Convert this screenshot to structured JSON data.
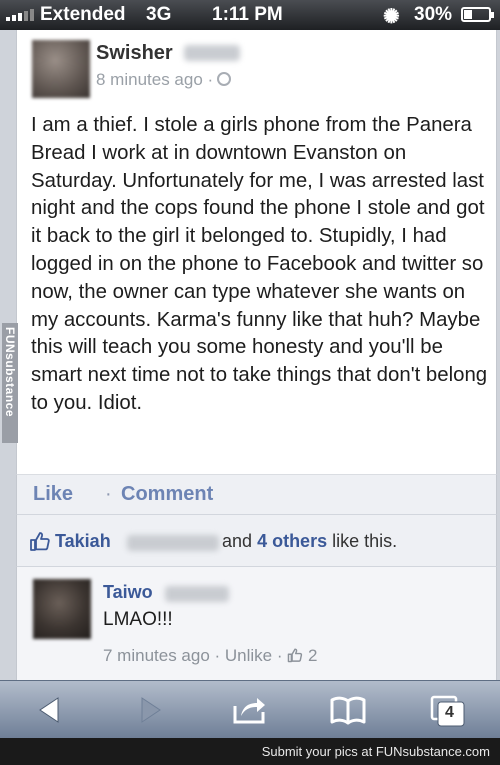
{
  "status_bar": {
    "carrier": "Extended",
    "network": "3G",
    "time": "1:11 PM",
    "battery": "30%",
    "icons": [
      "signal-icon",
      "loading-spinner-icon",
      "battery-icon"
    ]
  },
  "post": {
    "author": "Swisher",
    "timestamp": "8 minutes ago ·",
    "body": "I am a thief. I stole a girls phone from the Panera Bread I work at in downtown Evanston on Saturday. Unfortunately for me, I was arrested last night and the cops found the phone I stole and got it back to the girl it belonged to. Stupidly, I had logged in on the phone to Facebook and twitter so now, the owner can type whatever she wants on my accounts. Karma's funny like that huh? Maybe this will teach you some honesty and you'll be smart next time not to take things that don't belong to you. Idiot.",
    "like_label": "Like",
    "separator": "·",
    "comment_label": "Comment"
  },
  "likes": {
    "first_liker": "Takiah",
    "and_text": "and",
    "others": "4 others",
    "suffix": "like this."
  },
  "comment": {
    "author": "Taiwo",
    "text": "LMAO!!!",
    "meta": "7 minutes ago · Unlike ·",
    "like_count": "2"
  },
  "toolbar": {
    "tabs_count": "4",
    "icons": [
      "back-arrow-icon",
      "forward-arrow-icon",
      "share-icon",
      "bookmarks-icon",
      "tabs-icon"
    ]
  },
  "watermark": {
    "bottom": "Submit your pics at FUNsubstance.com",
    "side": "FUNsubstance"
  },
  "colors": {
    "facebook_blue": "#3b5998",
    "action_blue": "#6d84b4",
    "toolbar_top": "#b2bccb",
    "toolbar_bottom": "#6f7f97"
  }
}
